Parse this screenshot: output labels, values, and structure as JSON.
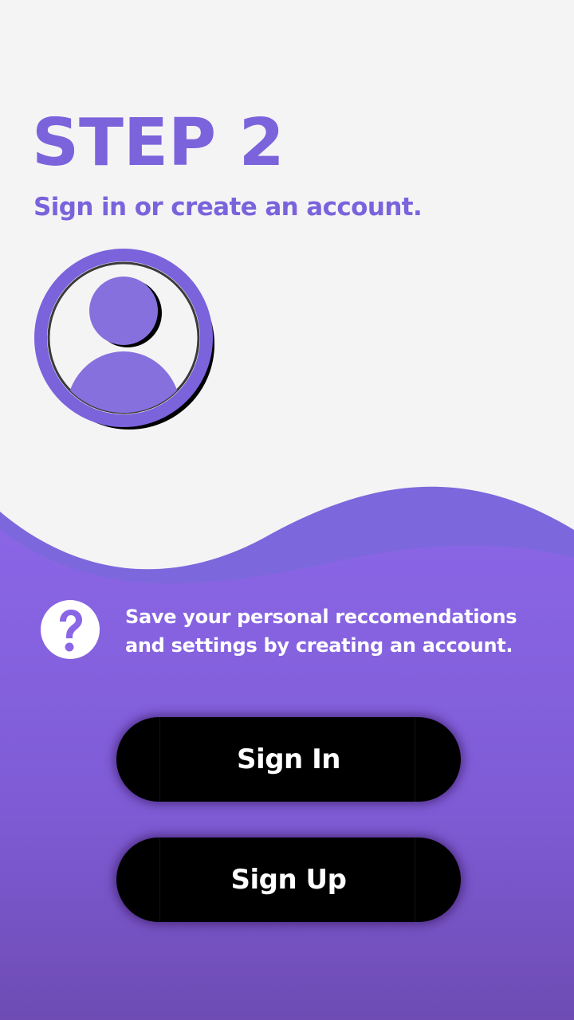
{
  "header": {
    "title": "STEP 2",
    "subtitle": "Sign in or create an account."
  },
  "avatar": {
    "icon": "user-profile-icon"
  },
  "info": {
    "icon": "help-circle-icon",
    "text": "Save your personal reccomendations and settings by creating an account."
  },
  "actions": {
    "sign_in_label": "Sign In",
    "sign_up_label": "Sign Up"
  },
  "colors": {
    "accent": "#7b63dc",
    "background": "#f4f4f5",
    "panel_top": "#8a66e6",
    "panel_bottom": "#6e4cb4",
    "button": "#000000",
    "button_text": "#ffffff"
  }
}
